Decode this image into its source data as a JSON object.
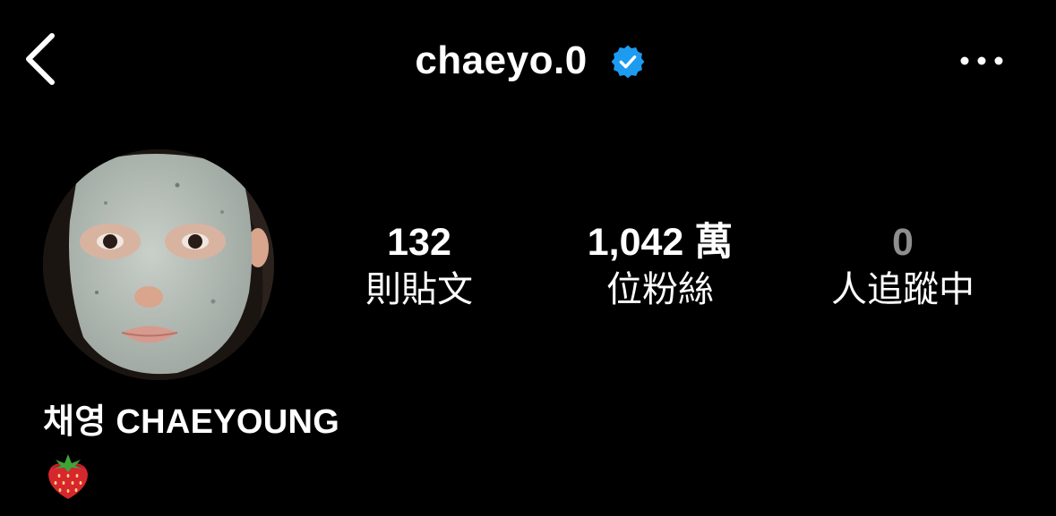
{
  "header": {
    "back_icon": "chevron-left-icon",
    "username": "chaeyo.0",
    "verified_icon": "verified-badge-icon",
    "verified_color": "#1d9bf0",
    "more_icon": "more-horizontal-icon"
  },
  "profile": {
    "avatar": "profile-photo",
    "stats": [
      {
        "value": "132",
        "label": "則貼文"
      },
      {
        "value": "1,042 萬",
        "label": "位粉絲"
      },
      {
        "value": "0",
        "label": "人追蹤中"
      }
    ],
    "display_name": "채영 CHAEYOUNG",
    "bio_emoji_icon": "strawberry-emoji-icon"
  },
  "colors": {
    "background": "#000000",
    "text": "#ffffff",
    "muted": "#8e8e8e"
  }
}
